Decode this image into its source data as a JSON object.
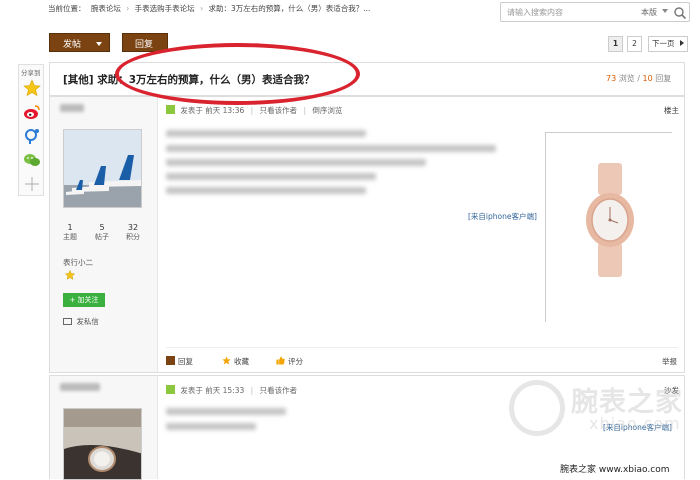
{
  "breadcrumb": {
    "prefix": "当前位置：",
    "items": [
      "腕表论坛",
      "手表选购手表论坛",
      "求助：3万左右的预算，什么（男）表适合我？..."
    ],
    "separator": "›"
  },
  "search": {
    "placeholder": "请输入搜索内容",
    "scope": "本版"
  },
  "toolbar": {
    "post_label": "发帖",
    "reply_label": "回复"
  },
  "pager": {
    "pages": [
      "1",
      "2"
    ],
    "next_label": "下一页"
  },
  "share": {
    "label": "分享到"
  },
  "thread": {
    "title": "[其他] 求助：3万左右的预算，什么（男）表适合我？",
    "views": "73",
    "views_label": "浏览",
    "replies": "10",
    "replies_label": "回复",
    "separator": "/"
  },
  "post1": {
    "meta_prefix": "发表于",
    "time": "前天 13:36",
    "only_author": "只看该作者",
    "reverse": "倒序浏览",
    "floor": "楼主",
    "stats": [
      {
        "num": "1",
        "label": "主题"
      },
      {
        "num": "5",
        "label": "帖子"
      },
      {
        "num": "32",
        "label": "积分"
      }
    ],
    "group": "表行小二",
    "follow": "+ 加关注",
    "message": "发私信",
    "source": "[来自iphone客户端]",
    "actions": {
      "reply": "回复",
      "favorite": "收藏",
      "rate": "评分",
      "report": "举报"
    }
  },
  "post2": {
    "meta_prefix": "发表于",
    "time": "前天 15:33",
    "only_author": "只看该作者",
    "floor": "沙发",
    "source": "[来自iphone客户端]"
  },
  "watermark": {
    "cn": "腕表之家",
    "en": "xbiao.com"
  },
  "footer": {
    "credit": "腕表之家 www.xbiao.com"
  },
  "colors": {
    "brand_brown": "#7a4311",
    "highlight_red": "#d9232e",
    "follow_green": "#3ab03e",
    "count_orange": "#d85a00"
  }
}
